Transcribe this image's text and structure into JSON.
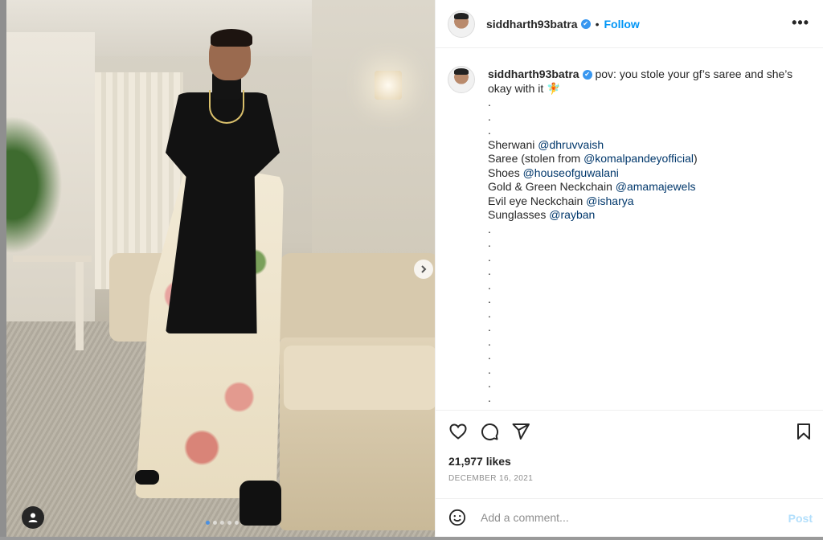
{
  "post": {
    "username": "siddharth93batra",
    "follow_label": "Follow",
    "separator": "•",
    "more_label": "•••",
    "caption_text": "pov: you stole your gf’s saree and she’s okay with it",
    "caption_emoji": "🧚",
    "dots_top": [
      ".",
      ".",
      "."
    ],
    "credits": [
      {
        "label": "Sherwani ",
        "mention": "@dhruvvaish",
        "suffix": ""
      },
      {
        "label": "Saree (stolen from ",
        "mention": "@komalpandeyofficial",
        "suffix": ")"
      },
      {
        "label": "Shoes ",
        "mention": "@houseofguwalani",
        "suffix": ""
      },
      {
        "label": "Gold & Green Neckchain ",
        "mention": "@amamajewels",
        "suffix": ""
      },
      {
        "label": "Evil eye Neckchain ",
        "mention": "@isharya",
        "suffix": ""
      },
      {
        "label": "Sunglasses ",
        "mention": "@rayban",
        "suffix": ""
      }
    ],
    "dots_bottom": [
      ".",
      ".",
      ".",
      ".",
      ".",
      ".",
      ".",
      ".",
      ".",
      ".",
      ".",
      ".",
      "."
    ],
    "likes": "21,977 likes",
    "date": "DECEMBER 16, 2021",
    "comment_placeholder": "Add a comment...",
    "post_label": "Post"
  },
  "carousel": {
    "next_icon": "chevron-right-icon",
    "slide_count": 5,
    "active_slide": 1
  },
  "icons": {
    "like": "heart-icon",
    "comment": "comment-icon",
    "share": "send-icon",
    "save": "bookmark-icon",
    "emoji": "emoji-icon",
    "tag": "user-tag-icon",
    "verified": "verified-badge-icon"
  },
  "colors": {
    "accent": "#0095f6",
    "verified": "#3897f0",
    "mention": "#00376b",
    "post_disabled": "#b2dffc"
  }
}
